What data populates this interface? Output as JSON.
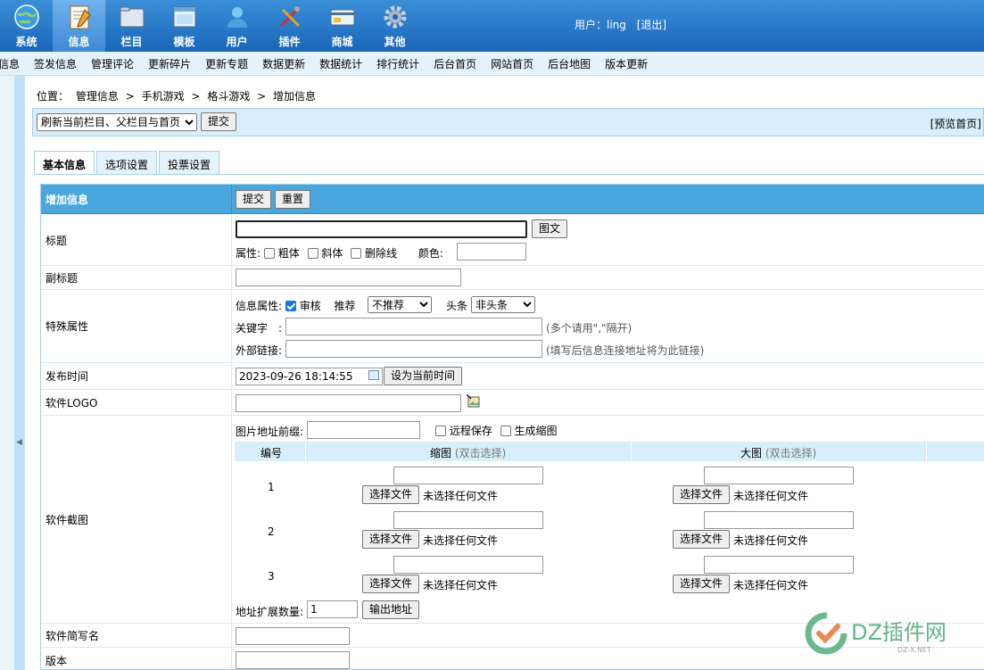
{
  "topnav": [
    {
      "label": "系统",
      "icon": "globe-icon"
    },
    {
      "label": "信息",
      "icon": "notepad-icon",
      "active": true
    },
    {
      "label": "栏目",
      "icon": "folder-icon"
    },
    {
      "label": "模板",
      "icon": "window-icon"
    },
    {
      "label": "用户",
      "icon": "user-icon"
    },
    {
      "label": "插件",
      "icon": "tools-icon"
    },
    {
      "label": "商城",
      "icon": "card-icon"
    },
    {
      "label": "其他",
      "icon": "gear-icon"
    }
  ],
  "user": {
    "text": "用户：ling",
    "logout": "[退出]"
  },
  "menu": [
    "信息",
    "签发信息",
    "管理评论",
    "更新碎片",
    "更新专题",
    "数据更新",
    "数据统计",
    "排行统计",
    "后台首页",
    "网站首页",
    "后台地图",
    "版本更新"
  ],
  "breadcrumb": {
    "prefix": "位置：",
    "items": [
      "管理信息",
      "手机游戏",
      "格斗游戏",
      "增加信息"
    ],
    "sep": ">"
  },
  "refresh": {
    "selected": "刷新当前栏目、父栏目与首页",
    "submit": "提交",
    "preview": "[预览首页]"
  },
  "tabs": [
    "基本信息",
    "选项设置",
    "投票设置"
  ],
  "form": {
    "header": {
      "label": "增加信息",
      "submit": "提交",
      "reset": "重置"
    },
    "title": {
      "label": "标题",
      "value": "",
      "button": "图文",
      "attr_label": "属性:",
      "bold": "粗体",
      "italic": "斜体",
      "strike": "删除线",
      "color_label": "颜色:"
    },
    "subtitle": {
      "label": "副标题"
    },
    "special": {
      "label": "特殊属性",
      "info_attr": "信息属性:",
      "audit": "审核",
      "recommend_label": "推荐",
      "recommend": "不推荐",
      "headline_label": "头条",
      "headline": "非头条",
      "keyword_label": "关键字　:",
      "keyword_hint": "(多个请用\",\"隔开)",
      "link_label": "外部链接:",
      "link_hint": "(填写后信息连接地址将为此链接)"
    },
    "publish": {
      "label": "发布时间",
      "value": "2023-09-26 18:14:55",
      "button": "设为当前时间"
    },
    "logo": {
      "label": "软件LOGO"
    },
    "screenshots": {
      "label": "软件截图",
      "prefix_label": "图片地址前缀:",
      "remote_save": "远程保存",
      "gen_thumb": "生成缩图",
      "col_no": "编号",
      "col_thumb": "缩图",
      "col_big": "大图",
      "dblclick": "(双击选择)",
      "choose": "选择文件",
      "no_file": "未选择任何文件",
      "rows": [
        "1",
        "2",
        "3"
      ],
      "ext_label": "地址扩展数量:",
      "ext_value": "1",
      "export": "输出地址"
    },
    "shortname": {
      "label": "软件简写名"
    },
    "version": {
      "label": "版本"
    }
  },
  "watermark": {
    "brand": "DZ插件网",
    "sub": "DZ-X.NET"
  }
}
